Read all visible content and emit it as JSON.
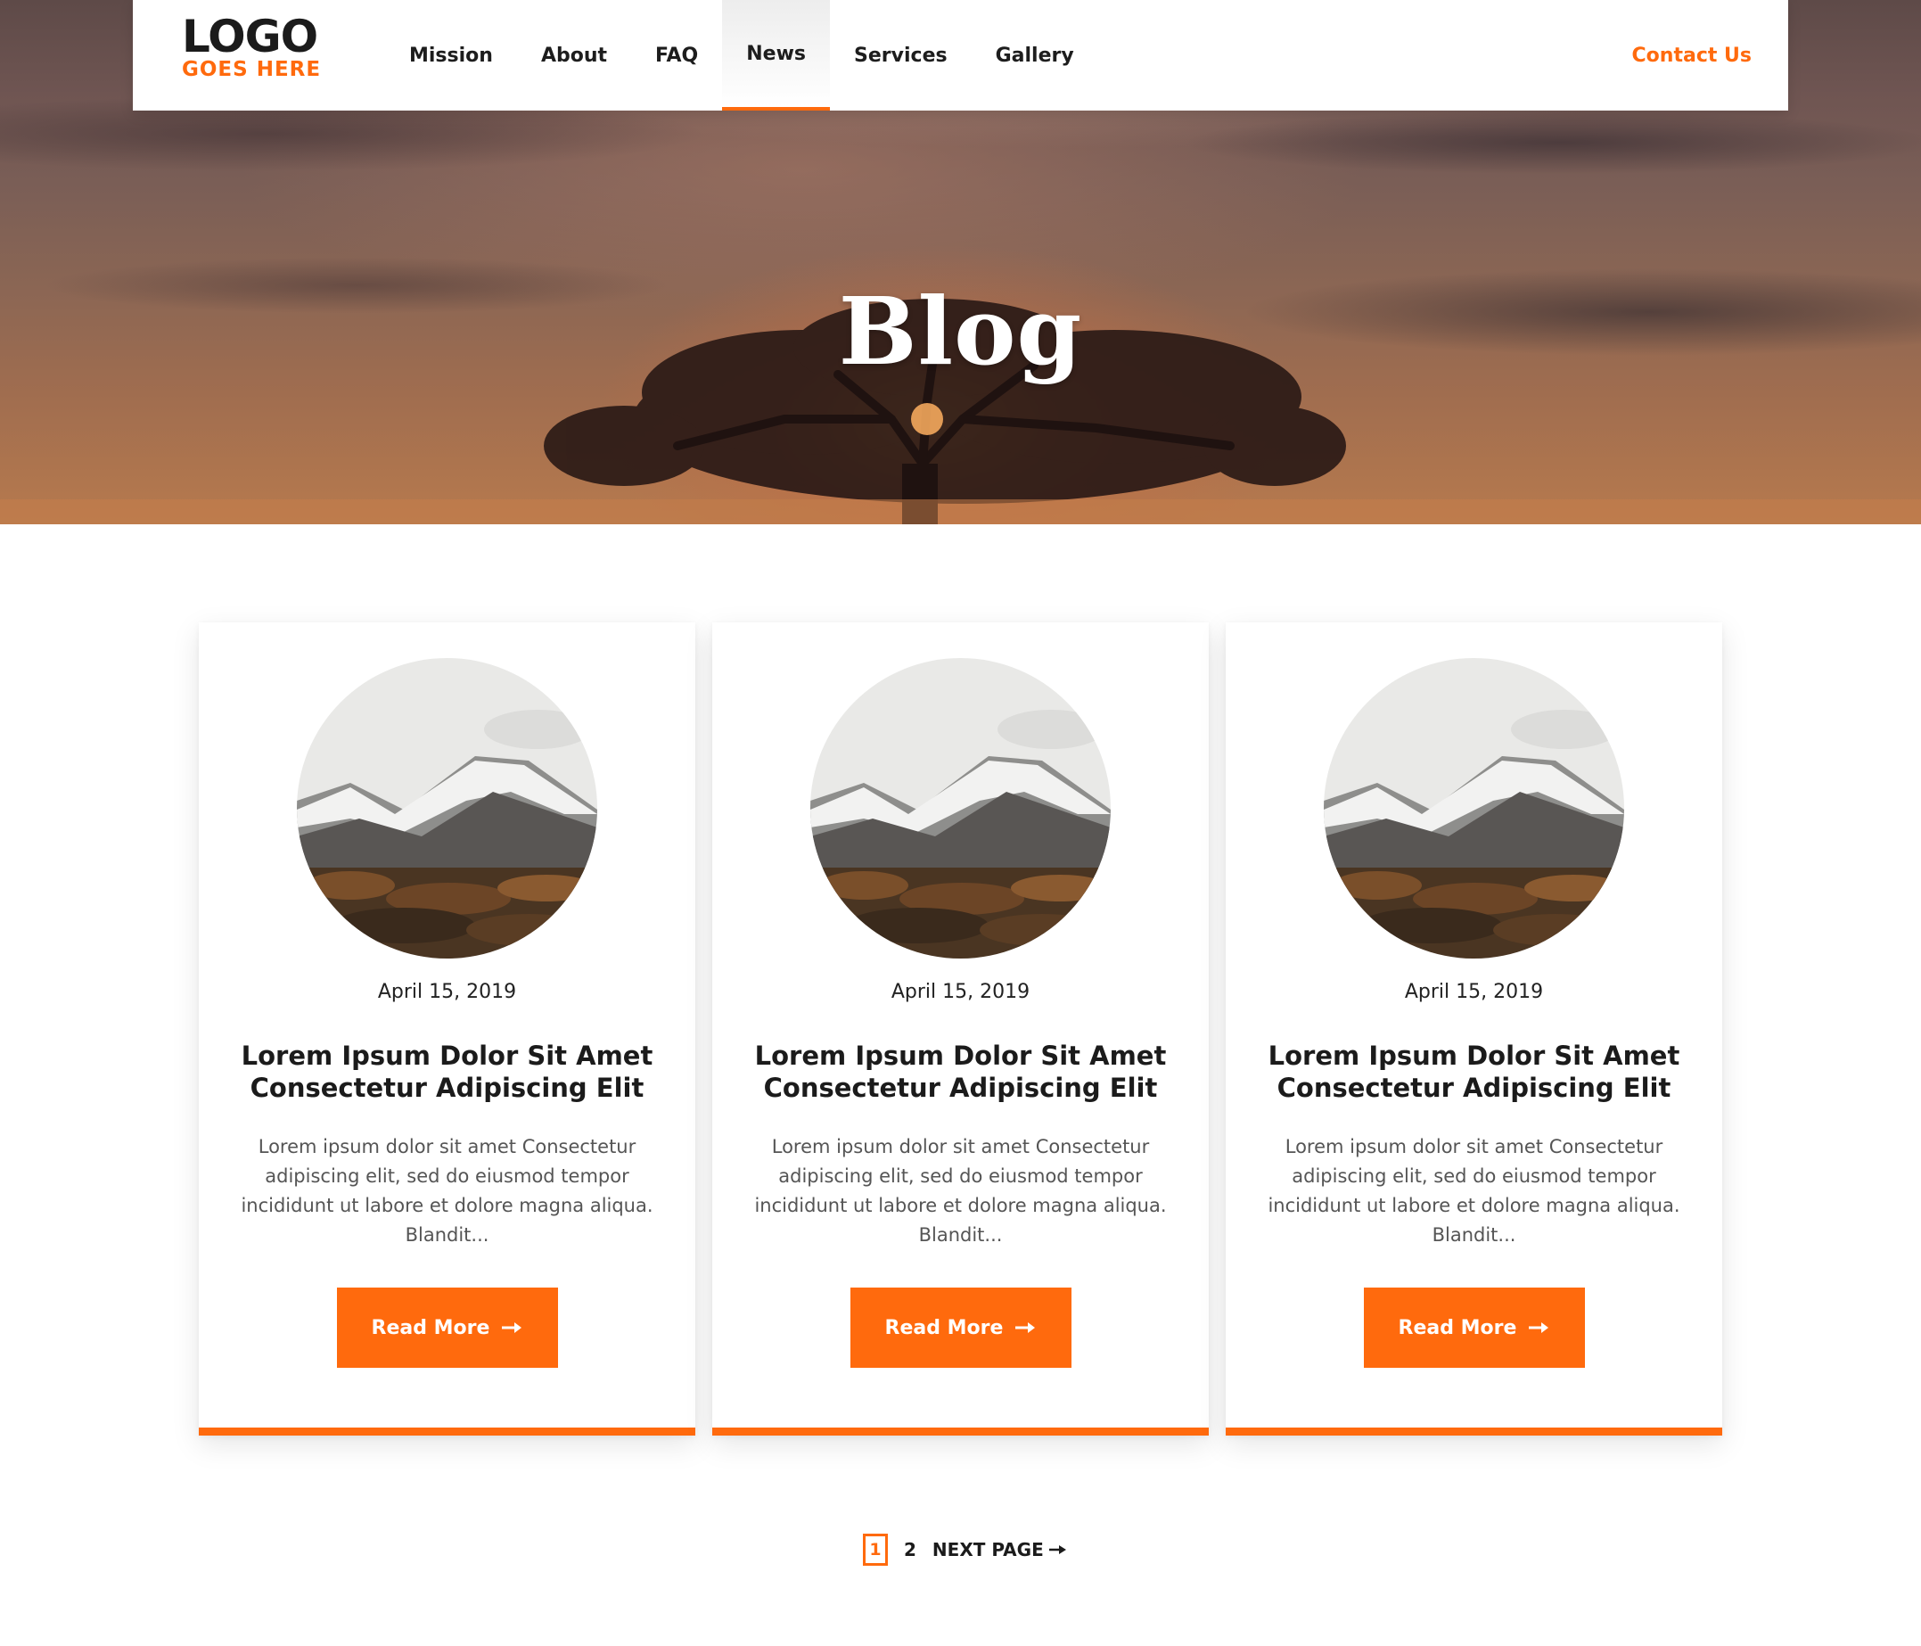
{
  "header": {
    "logo_main": "LOGO",
    "logo_sub": "GOES HERE",
    "nav": [
      {
        "label": "Mission",
        "active": false
      },
      {
        "label": "About",
        "active": false
      },
      {
        "label": "FAQ",
        "active": false
      },
      {
        "label": "News",
        "active": true
      },
      {
        "label": "Services",
        "active": false
      },
      {
        "label": "Gallery",
        "active": false
      }
    ],
    "contact_label": "Contact Us"
  },
  "hero": {
    "title": "Blog"
  },
  "posts": [
    {
      "date": "April 15, 2019",
      "title": "Lorem Ipsum Dolor Sit Amet Consectetur Adipiscing Elit",
      "excerpt": "Lorem ipsum dolor sit amet Consectetur adipiscing elit, sed do eiusmod tempor incididunt ut labore et dolore magna aliqua. Blandit...",
      "button_label": "Read More"
    },
    {
      "date": "April 15, 2019",
      "title": "Lorem Ipsum Dolor Sit Amet Consectetur Adipiscing Elit",
      "excerpt": "Lorem ipsum dolor sit amet Consectetur adipiscing elit, sed do eiusmod tempor incididunt ut labore et dolore magna aliqua. Blandit...",
      "button_label": "Read More"
    },
    {
      "date": "April 15, 2019",
      "title": "Lorem Ipsum Dolor Sit Amet Consectetur Adipiscing Elit",
      "excerpt": "Lorem ipsum dolor sit amet Consectetur adipiscing elit, sed do eiusmod tempor incididunt ut labore et dolore magna aliqua. Blandit...",
      "button_label": "Read More"
    }
  ],
  "pagination": {
    "current": "1",
    "pages": [
      "2"
    ],
    "next_label": "NEXT PAGE"
  },
  "colors": {
    "accent": "#ff6a0d",
    "text_dark": "#1b1b1b",
    "text_muted": "#555555"
  }
}
